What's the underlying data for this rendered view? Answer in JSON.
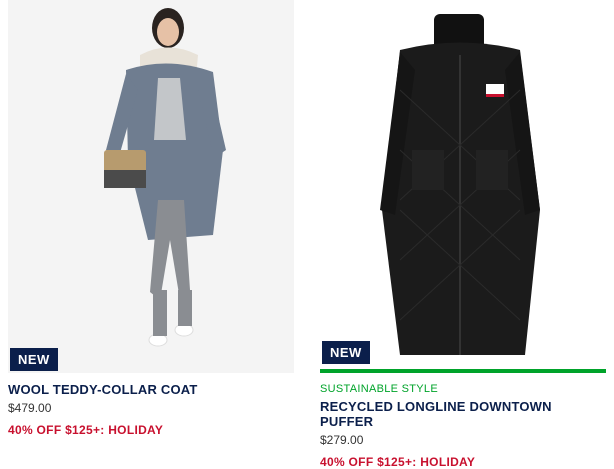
{
  "products": [
    {
      "badge": "NEW",
      "eyebrow": "",
      "title": "WOOL TEDDY-COLLAR COAT",
      "price": "$479.00",
      "promo": "40% OFF $125+: HOLIDAY"
    },
    {
      "badge": "NEW",
      "eyebrow": "SUSTAINABLE STYLE",
      "title": "RECYCLED LONGLINE DOWNTOWN PUFFER",
      "price": "$279.00",
      "promo": "40% OFF $125+: HOLIDAY"
    }
  ],
  "colors": {
    "navy": "#0b1f4b",
    "promo_red": "#c8102e",
    "sustainable_green": "#00a32a"
  }
}
